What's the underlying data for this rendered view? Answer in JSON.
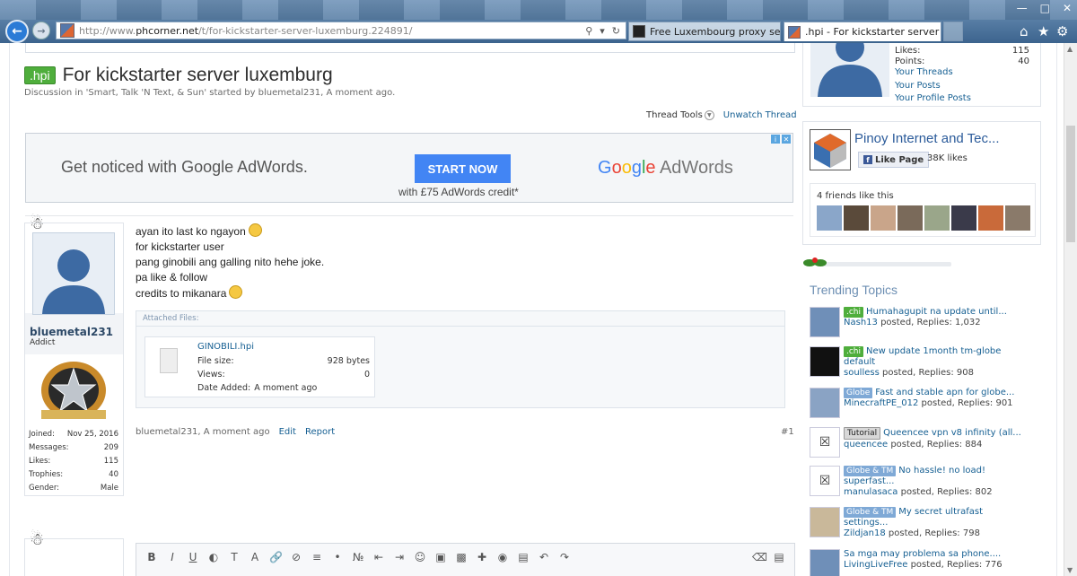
{
  "browser": {
    "url_prefix": "http://www.",
    "url_domain": "phcorner.net",
    "url_path": "/t/for-kickstarter-server-luxemburg.224891/",
    "tabs": [
      {
        "label": "Free Luxembourg proxy servers."
      },
      {
        "label": ".hpi - For kickstarter server l..."
      }
    ]
  },
  "thread": {
    "prefix": ".hpi",
    "title": "For kickstarter server luxemburg",
    "subtitle": "Discussion in 'Smart, Talk 'N Text, & Sun' started by bluemetal231, A moment ago.",
    "thread_tools": "Thread Tools",
    "unwatch": "Unwatch Thread"
  },
  "ad": {
    "message": "Get noticed with Google AdWords.",
    "cta": "START NOW",
    "brand": "Google AdWords",
    "credit": "with £75 AdWords credit*"
  },
  "post": {
    "lines": [
      "ayan ito last ko ngayon",
      "for kickstarter user",
      "pang ginobili ang galling nito hehe joke.",
      "pa like & follow",
      "credits to mikanara"
    ],
    "author": "bluemetal231",
    "rank": "Addict",
    "stats": [
      {
        "k": "Joined:",
        "v": "Nov 25, 2016"
      },
      {
        "k": "Messages:",
        "v": "209"
      },
      {
        "k": "Likes:",
        "v": "115"
      },
      {
        "k": "Trophies:",
        "v": "40"
      },
      {
        "k": "Gender:",
        "v": "Male"
      }
    ],
    "attach_header": "Attached Files:",
    "file": {
      "name": "GINOBILI.hpi",
      "size_label": "File size:",
      "size": "928 bytes",
      "views_label": "Views:",
      "views": "0",
      "date_label": "Date Added:",
      "date": "A moment ago"
    },
    "footer": {
      "byline": "bluemetal231, A moment ago",
      "edit": "Edit",
      "report": "Report",
      "num": "#1"
    }
  },
  "sidebar": {
    "profile": {
      "likes_label": "Likes:",
      "likes": "115",
      "points_label": "Points:",
      "points": "40",
      "links": [
        "Your Threads",
        "Your Posts",
        "Your Profile Posts"
      ]
    },
    "facebook": {
      "page": "Pinoy Internet and Tec...",
      "like": "Like Page",
      "count": "38K likes",
      "friends": "4 friends like this"
    },
    "trending_title": "Trending Topics",
    "trending": [
      {
        "tag": ".chi",
        "tagtype": "chi",
        "title": "Humahagupit na update until...",
        "title2": "",
        "user": "Nash13",
        "replies": "posted, Replies: 1,032"
      },
      {
        "tag": ".chi",
        "tagtype": "chi",
        "title": "New update 1month tm-globe",
        "title2": "default",
        "user": "soulless",
        "replies": "posted, Replies: 908"
      },
      {
        "tag": "Globe",
        "tagtype": "glb",
        "title": "Fast and stable apn for globe...",
        "title2": "",
        "user": "MinecraftPE_012",
        "replies": "posted, Replies: 901"
      },
      {
        "tag": "Tutorial",
        "tagtype": "tut",
        "title": "Queencee vpn v8 infinity (all...",
        "title2": "",
        "user": "queencee",
        "replies": "posted, Replies: 884"
      },
      {
        "tag": "Globe & TM",
        "tagtype": "glb",
        "title": "No hassle! no load!",
        "title2": "superfast...",
        "user": "manulasaca",
        "replies": "posted, Replies: 802"
      },
      {
        "tag": "Globe & TM",
        "tagtype": "glb",
        "title": "My secret ultrafast",
        "title2": "settings...",
        "user": "Zildjan18",
        "replies": "posted, Replies: 798"
      },
      {
        "tag": "",
        "tagtype": "",
        "title": "Sa mga may problema sa phone....",
        "title2": "",
        "user": "LivingLiveFree",
        "replies": "posted, Replies: 776"
      }
    ]
  }
}
